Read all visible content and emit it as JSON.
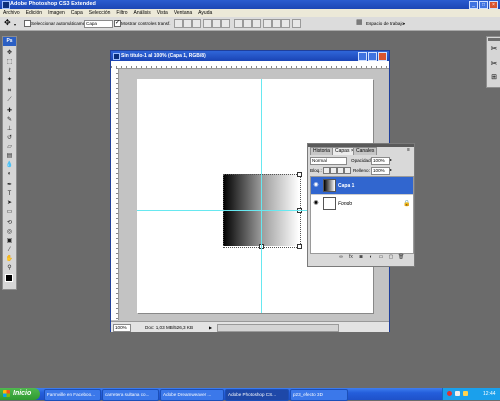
{
  "app": {
    "title": "Adobe Photoshop CS3 Extended"
  },
  "menu": [
    "Archivo",
    "Edición",
    "Imagen",
    "Capa",
    "Selección",
    "Filtro",
    "Análisis",
    "Vista",
    "Ventana",
    "Ayuda"
  ],
  "options": {
    "auto_select_label": "Seleccionar automáticamente:",
    "auto_select_value": "Capa",
    "show_transform_label": "Mostrar controles transf.",
    "workspace_label": "Espacio de trabajo"
  },
  "tools": {
    "header": "Ps"
  },
  "document": {
    "title": "Sin título-1 al 100% (Capa 1, RGB/8)",
    "zoom": "100%",
    "status": "Doc: 1,03 MB/526,3 KB"
  },
  "layers_panel": {
    "tabs": [
      "Historia",
      "Capas ×",
      "Canales"
    ],
    "blend_mode": "Normal",
    "opacity_label": "Opacidad:",
    "opacity_value": "100%",
    "lock_label": "Bloq.:",
    "fill_label": "Relleno:",
    "fill_value": "100%",
    "layers": [
      {
        "name": "Capa 1",
        "selected": true
      },
      {
        "name": "Fondo",
        "selected": false
      }
    ]
  },
  "taskbar": {
    "start_label": "Inicio",
    "tasks": [
      {
        "label": "Farmville en Faceboo..."
      },
      {
        "label": "carretera sultana co..."
      },
      {
        "label": "Adobe Dreamweaver ..."
      },
      {
        "label": "Adobe Photoshop CS..."
      },
      {
        "label": "p23_efecto 3D"
      }
    ],
    "clock": "12:44"
  }
}
